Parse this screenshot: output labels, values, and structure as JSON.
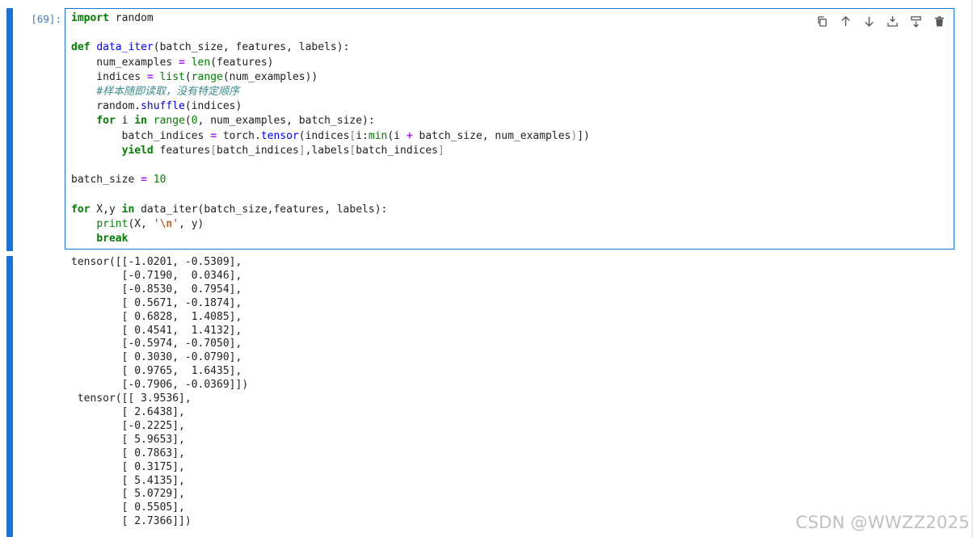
{
  "cell": {
    "prompt": "[69]:",
    "toolbar": {
      "duplicate": "duplicate-icon",
      "move_up": "arrow-up-icon",
      "move_down": "arrow-down-icon",
      "insert_above": "insert-above-icon",
      "insert_below": "insert-below-icon",
      "delete": "trash-icon"
    },
    "code_lines": [
      "import random",
      "",
      "def data_iter(batch_size, features, labels):",
      "    num_examples = len(features)",
      "    indices = list(range(num_examples))",
      "    #样本随即读取，没有特定顺序",
      "    random.shuffle(indices)",
      "    for i in range(0, num_examples, batch_size):",
      "        batch_indices = torch.tensor(indices[i:min(i + batch_size, num_examples)])",
      "        yield features[batch_indices],labels[batch_indices]",
      "",
      "batch_size = 10",
      "",
      "for X,y in data_iter(batch_size,features, labels):",
      "    print(X, '\\n', y)",
      "    break"
    ]
  },
  "output": {
    "lines": [
      "tensor([[-1.0201, -0.5309],",
      "        [-0.7190,  0.0346],",
      "        [-0.8530,  0.7954],",
      "        [ 0.5671, -0.1874],",
      "        [ 0.6828,  1.4085],",
      "        [ 0.4541,  1.4132],",
      "        [-0.5974, -0.7050],",
      "        [ 0.3030, -0.0790],",
      "        [ 0.9765,  1.6435],",
      "        [-0.7906, -0.0369]])",
      " tensor([[ 3.9536],",
      "        [ 2.6438],",
      "        [-0.2225],",
      "        [ 5.9653],",
      "        [ 0.7863],",
      "        [ 0.3175],",
      "        [ 5.4135],",
      "        [ 5.0729],",
      "        [ 0.5505],",
      "        [ 2.7366]])"
    ]
  },
  "watermark": "CSDN @WWZZ2025",
  "colors": {
    "accent": "#1a73d9",
    "keyword": "#008000",
    "function_name": "#0000ff",
    "comment": "#3d8b8b",
    "string": "#ba2121",
    "operator": "#aa22ff"
  }
}
